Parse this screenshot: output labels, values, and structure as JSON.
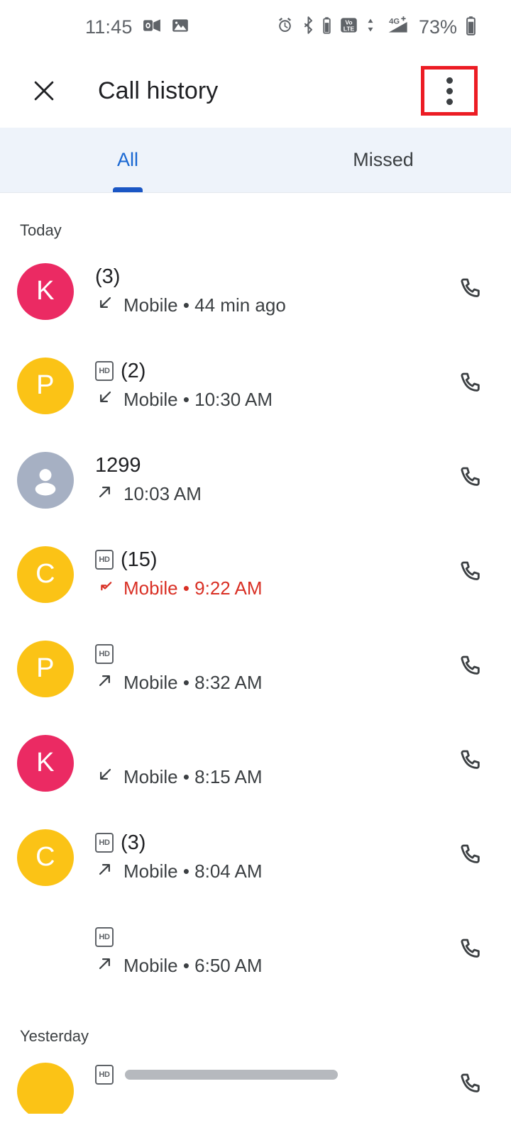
{
  "status_bar": {
    "time": "11:45",
    "battery_percent": "73%",
    "left_icons": [
      "outlook-icon",
      "photos-icon"
    ],
    "right_icons": [
      "alarm-icon",
      "bluetooth-icon",
      "bluetooth-battery-icon",
      "volte-icon",
      "mobile-data-icon",
      "signal-4g-plus-icon",
      "battery-icon"
    ],
    "network_label": "4G+",
    "volte_label_top": "VoLTE",
    "volte_label_line1": "Vo",
    "volte_label_line2": "LTE"
  },
  "app_bar": {
    "close_label": "✕",
    "title": "Call history",
    "overflow_label": "More options",
    "highlight_color": "#ec1c24"
  },
  "tabs": {
    "active_index": 0,
    "accent_color": "#1967d2",
    "items": [
      {
        "label": "All"
      },
      {
        "label": "Missed"
      }
    ]
  },
  "sections": [
    {
      "header": "Today",
      "rows": [
        {
          "avatar_letter": "K",
          "avatar_color": "#eb2a63",
          "avatar_type": "letter",
          "name": "",
          "count": "(3)",
          "hd": false,
          "direction": "incoming",
          "direction_icon": "incoming-call-icon",
          "detail": "Mobile • 44 min ago",
          "missed": false,
          "call_action": "call-button"
        },
        {
          "avatar_letter": "P",
          "avatar_color": "#fbc316",
          "avatar_type": "letter",
          "name": "",
          "count": "(2)",
          "hd": true,
          "direction": "incoming",
          "direction_icon": "incoming-call-icon",
          "detail": "Mobile • 10:30 AM",
          "missed": false,
          "call_action": "call-button"
        },
        {
          "avatar_letter": "",
          "avatar_color": "#a6b0c3",
          "avatar_type": "person",
          "name": "1299",
          "count": "",
          "hd": false,
          "direction": "outgoing",
          "direction_icon": "outgoing-call-icon",
          "detail": "10:03 AM",
          "missed": false,
          "call_action": "call-button"
        },
        {
          "avatar_letter": "C",
          "avatar_color": "#fbc316",
          "avatar_type": "letter",
          "name": "",
          "count": "(15)",
          "hd": true,
          "direction": "missed",
          "direction_icon": "missed-call-icon",
          "detail": "Mobile • 9:22 AM",
          "missed": true,
          "call_action": "call-button"
        },
        {
          "avatar_letter": "P",
          "avatar_color": "#fbc316",
          "avatar_type": "letter",
          "name": "",
          "count": "",
          "hd": true,
          "direction": "outgoing",
          "direction_icon": "outgoing-call-icon",
          "detail": "Mobile • 8:32 AM",
          "missed": false,
          "call_action": "call-button"
        },
        {
          "avatar_letter": "K",
          "avatar_color": "#eb2a63",
          "avatar_type": "letter",
          "name": "",
          "count": "",
          "hd": false,
          "direction": "incoming",
          "direction_icon": "incoming-call-icon",
          "detail": "Mobile • 8:15 AM",
          "missed": false,
          "call_action": "call-button"
        },
        {
          "avatar_letter": "C",
          "avatar_color": "#fbc316",
          "avatar_type": "letter",
          "name": "",
          "count": "(3)",
          "hd": true,
          "direction": "outgoing",
          "direction_icon": "outgoing-call-icon",
          "detail": "Mobile • 8:04 AM",
          "missed": false,
          "call_action": "call-button"
        },
        {
          "avatar_letter": "",
          "avatar_color": "transparent",
          "avatar_type": "blank",
          "name": "",
          "count": "",
          "hd": true,
          "direction": "outgoing",
          "direction_icon": "outgoing-call-icon",
          "detail": "Mobile • 6:50 AM",
          "missed": false,
          "call_action": "call-button"
        }
      ]
    },
    {
      "header": "Yesterday",
      "rows": [
        {
          "avatar_letter": "",
          "avatar_color": "#fbc316",
          "avatar_type": "letter",
          "name": "",
          "count": "",
          "hd": true,
          "direction": "none",
          "direction_icon": "",
          "detail": "",
          "missed": false,
          "partial": true,
          "call_action": "call-button"
        }
      ]
    }
  ]
}
